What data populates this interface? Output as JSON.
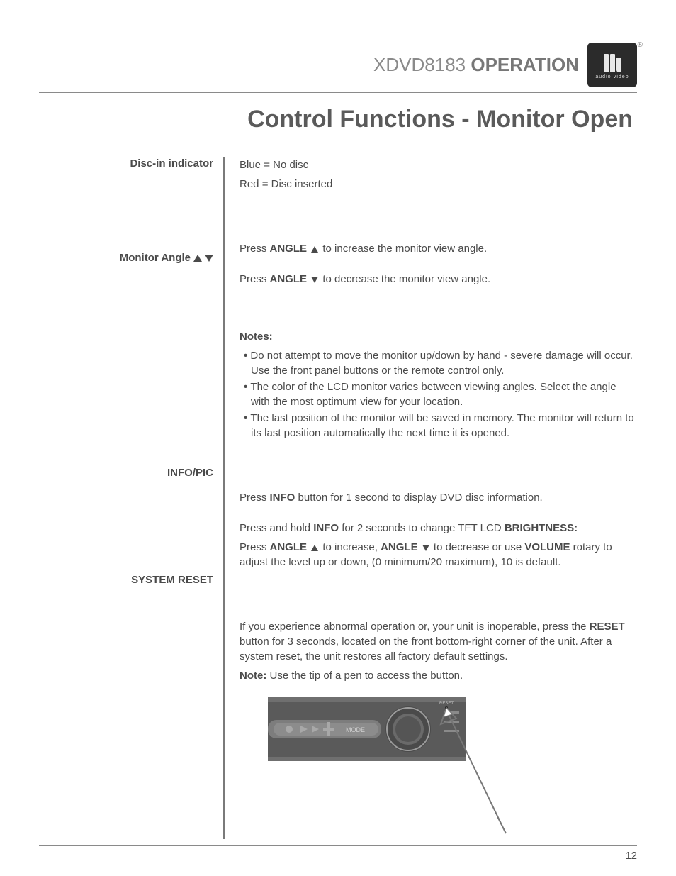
{
  "header": {
    "model": "XDVD8183",
    "operation": "OPERATION",
    "logoSub": "audio·video"
  },
  "sectionTitle": "Control Functions - Monitor Open",
  "sections": {
    "discIn": {
      "label": "Disc-in indicator",
      "line1a": "Blue",
      "line1b": " = No disc",
      "line2a": "Red",
      "line2b": "  = Disc inserted"
    },
    "monitorAngle": {
      "label": "Monitor Angle",
      "p1a": "Press ",
      "p1b": "ANGLE",
      "p1c": " to increase the monitor view angle.",
      "p2a": "Press ",
      "p2b": "ANGLE",
      "p2c": " to decrease the monitor view angle.",
      "notesTitle": "Notes:",
      "note1": "Do not attempt to move the monitor up/down by hand - severe damage will occur. Use the front panel buttons or the remote control only.",
      "note2": "The color of the LCD monitor varies between viewing angles. Select the angle with the most optimum view for your location.",
      "note3": "The last position of the monitor will be saved in memory. The monitor will return to its last position automatically the next time it is opened."
    },
    "infoPic": {
      "label": "INFO/PIC",
      "p1a": "Press ",
      "p1b": "INFO",
      "p1c": " button for 1 second to display DVD disc information.",
      "p2a": "Press and hold ",
      "p2b": "INFO",
      "p2c": " for 2 seconds to change TFT LCD ",
      "p2d": "BRIGHTNESS:",
      "p3a": "Press ",
      "p3b": "ANGLE",
      "p3c": " to increase, ",
      "p3d": "ANGLE",
      "p3e": " to decrease or use ",
      "p3f": "VOLUME",
      "p3g": " rotary to adjust the level up or down, (0 minimum/20 maximum), 10 is default."
    },
    "reset": {
      "label": "SYSTEM RESET",
      "p1a": "If you experience abnormal operation or, your unit is inoperable, press the ",
      "p1b": "RESET",
      "p1c": " button for 3 seconds, located on the front bottom-right corner of the unit. After a system reset, the unit restores all factory default settings.",
      "p2a": "Note:",
      "p2b": " Use the tip of a pen to access the button."
    },
    "illus": {
      "resetLabel": "RESET",
      "modeLabel": "MODE"
    }
  },
  "pageNumber": "12"
}
